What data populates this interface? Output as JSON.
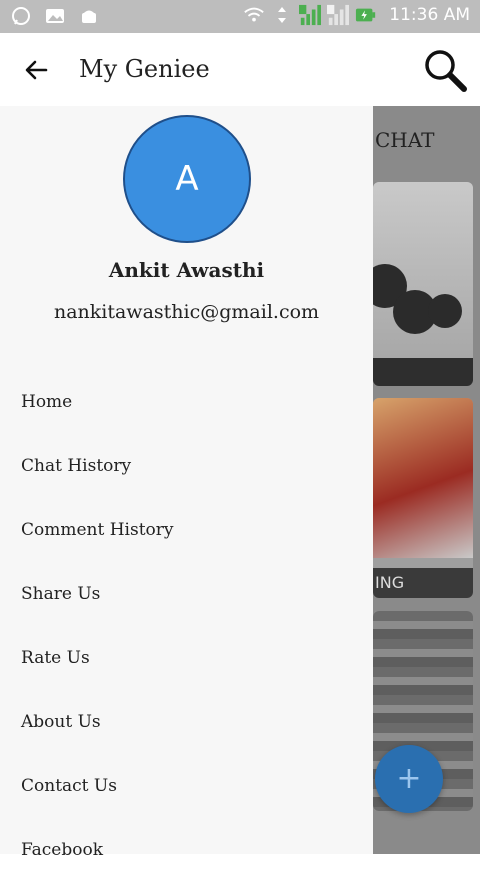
{
  "status_bar": {
    "time": "11:36 AM",
    "left_icons": [
      "whatsapp-icon",
      "gallery-icon",
      "android-icon"
    ],
    "right_icons": [
      "wifi-icon",
      "data-arrows-icon",
      "signal-sim1-icon",
      "signal-sim2-icon",
      "battery-charging-icon"
    ],
    "sim1": "1",
    "sim2": "2"
  },
  "app_bar": {
    "title": "My Geniee",
    "back_icon": "arrow-left-icon",
    "search_icon": "search-icon"
  },
  "drawer": {
    "avatar_initial": "A",
    "user_name": "Ankit Awasthi",
    "email": "nankitawasthic@gmail.com",
    "menu": [
      {
        "label": "Home"
      },
      {
        "label": "Chat History"
      },
      {
        "label": "Comment History"
      },
      {
        "label": "Share Us"
      },
      {
        "label": "Rate Us"
      },
      {
        "label": "About Us"
      },
      {
        "label": "Contact Us"
      },
      {
        "label": "Facebook"
      }
    ]
  },
  "background": {
    "tab_label": "CHAT",
    "card2_label": "ING",
    "fab_icon": "plus-icon",
    "fab_symbol": "+"
  },
  "colors": {
    "status_bar": "#bdbdbd",
    "avatar": "#3a8fe0",
    "fab": "#2a6fb0",
    "drawer_bg": "#f7f7f7"
  }
}
